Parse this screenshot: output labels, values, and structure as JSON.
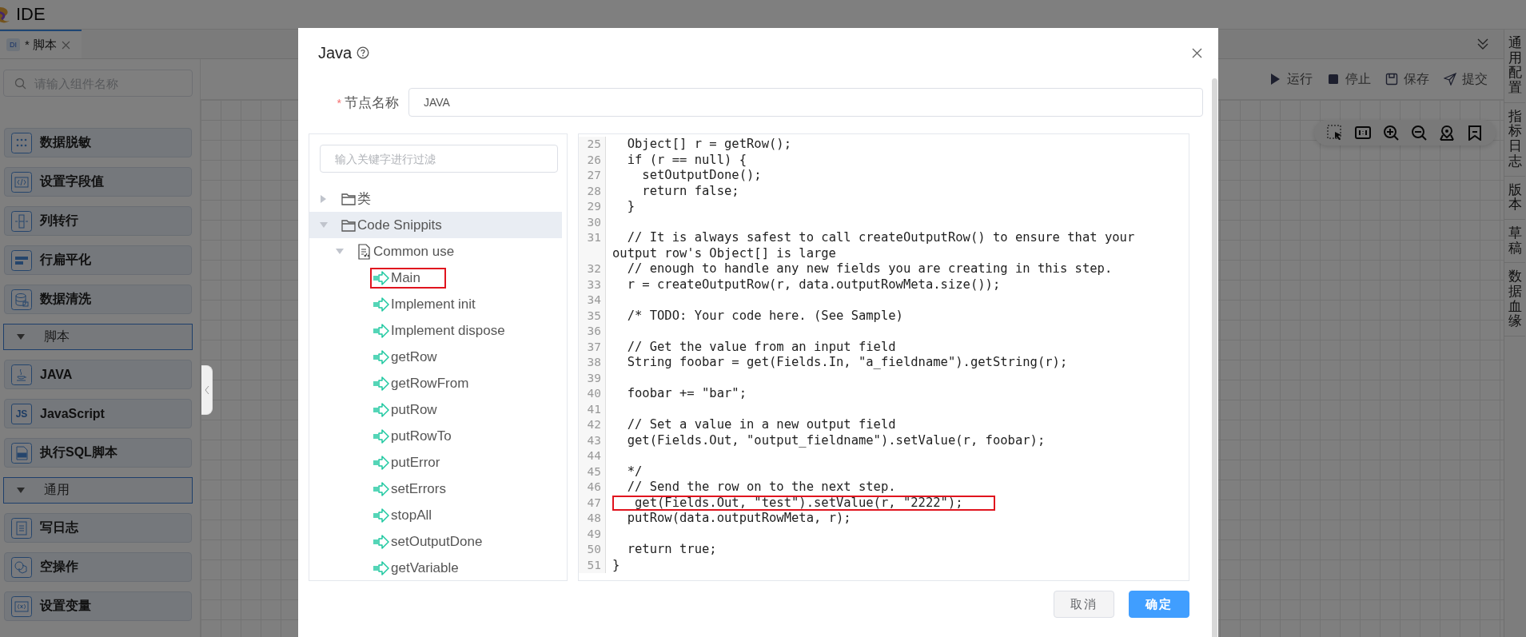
{
  "app": {
    "title": "IDE"
  },
  "tabs": [
    {
      "badge": "DI",
      "label": "* 脚本",
      "selected": true
    }
  ],
  "sidebar": {
    "search": {
      "placeholder": "请输入组件名称"
    },
    "items": [
      {
        "kind": "item",
        "label": "数据脱敏"
      },
      {
        "kind": "item",
        "label": "设置字段值"
      },
      {
        "kind": "item",
        "label": "列转行"
      },
      {
        "kind": "item",
        "label": "行扁平化"
      },
      {
        "kind": "item",
        "label": "数据清洗"
      },
      {
        "kind": "group",
        "label": "脚本",
        "expanded": true
      },
      {
        "kind": "item",
        "label": "JAVA"
      },
      {
        "kind": "item",
        "label": "JavaScript",
        "badge": "JS"
      },
      {
        "kind": "item",
        "label": "执行SQL脚本"
      },
      {
        "kind": "group",
        "label": "通用",
        "expanded": true
      },
      {
        "kind": "item",
        "label": "写日志"
      },
      {
        "kind": "item",
        "label": "空操作"
      },
      {
        "kind": "item",
        "label": "设置变量"
      }
    ]
  },
  "toolbar": {
    "actions": [
      "运行",
      "停止",
      "保存",
      "提交"
    ]
  },
  "side_tabs": [
    "通用配置",
    "指标日志",
    "版本",
    "草稿",
    "数据血缘"
  ],
  "dialog": {
    "title": "Java",
    "node_name": {
      "required_mark": "*",
      "label": "节点名称",
      "value": "JAVA"
    },
    "tree": {
      "filter": {
        "placeholder": "输入关键字进行过滤"
      },
      "nodes": [
        {
          "kind": "folder",
          "label": "类",
          "expanded": false,
          "selected": false,
          "marked": false
        },
        {
          "kind": "folder",
          "label": "Code Snippits",
          "expanded": true,
          "selected": true,
          "marked": false,
          "children": [
            {
              "kind": "file",
              "label": "Common use",
              "expanded": true,
              "selected": false,
              "marked": false,
              "children": [
                {
                  "kind": "snippet",
                  "label": "Main",
                  "selected": false,
                  "marked": true
                },
                {
                  "kind": "snippet",
                  "label": "Implement init",
                  "selected": false,
                  "marked": false
                },
                {
                  "kind": "snippet",
                  "label": "Implement dispose",
                  "selected": false,
                  "marked": false
                },
                {
                  "kind": "snippet",
                  "label": "getRow",
                  "selected": false,
                  "marked": false
                },
                {
                  "kind": "snippet",
                  "label": "getRowFrom",
                  "selected": false,
                  "marked": false
                },
                {
                  "kind": "snippet",
                  "label": "putRow",
                  "selected": false,
                  "marked": false
                },
                {
                  "kind": "snippet",
                  "label": "putRowTo",
                  "selected": false,
                  "marked": false
                },
                {
                  "kind": "snippet",
                  "label": "putError",
                  "selected": false,
                  "marked": false
                },
                {
                  "kind": "snippet",
                  "label": "setErrors",
                  "selected": false,
                  "marked": false
                },
                {
                  "kind": "snippet",
                  "label": "stopAll",
                  "selected": false,
                  "marked": false
                },
                {
                  "kind": "snippet",
                  "label": "setOutputDone",
                  "selected": false,
                  "marked": false
                },
                {
                  "kind": "snippet",
                  "label": "getVariable",
                  "selected": false,
                  "marked": false
                }
              ]
            }
          ]
        }
      ]
    },
    "code": {
      "lines": [
        {
          "n": "25",
          "text": "  Object[] r = getRow();",
          "marked": false
        },
        {
          "n": "26",
          "text": "  if (r == null) {",
          "marked": false
        },
        {
          "n": "27",
          "text": "    setOutputDone();",
          "marked": false
        },
        {
          "n": "28",
          "text": "    return false;",
          "marked": false
        },
        {
          "n": "29",
          "text": "  }",
          "marked": false
        },
        {
          "n": "30",
          "marked": false
        },
        {
          "n": "31",
          "text": "  // It is always safest to call createOutputRow() to ensure that your output row's Object[] is large",
          "marked": false
        },
        {
          "n": "32",
          "text": "  // enough to handle any new fields you are creating in this step.",
          "marked": false
        },
        {
          "n": "33",
          "text": "  r = createOutputRow(r, data.outputRowMeta.size());",
          "marked": false
        },
        {
          "n": "34",
          "marked": false
        },
        {
          "n": "35",
          "text": "  /* TODO: Your code here. (See Sample)",
          "marked": false
        },
        {
          "n": "36",
          "marked": false
        },
        {
          "n": "37",
          "text": "  // Get the value from an input field",
          "marked": false
        },
        {
          "n": "38",
          "text": "  String foobar = get(Fields.In, \"a_fieldname\").getString(r);",
          "marked": false
        },
        {
          "n": "39",
          "marked": false
        },
        {
          "n": "40",
          "text": "  foobar += \"bar\";",
          "marked": false
        },
        {
          "n": "41",
          "marked": false
        },
        {
          "n": "42",
          "text": "  // Set a value in a new output field",
          "marked": false
        },
        {
          "n": "43",
          "text": "  get(Fields.Out, \"output_fieldname\").setValue(r, foobar);",
          "marked": false
        },
        {
          "n": "44",
          "marked": false
        },
        {
          "n": "45",
          "text": "  */",
          "marked": false
        },
        {
          "n": "46",
          "text": "  // Send the row on to the next step.",
          "marked": false
        },
        {
          "n": "47",
          "text": "   get(Fields.Out, \"test\").setValue(r, \"2222\");",
          "marked": true
        },
        {
          "n": "48",
          "text": "  putRow(data.outputRowMeta, r);",
          "marked": false
        },
        {
          "n": "49",
          "marked": false
        },
        {
          "n": "50",
          "text": "  return true;",
          "marked": false
        },
        {
          "n": "51",
          "text": "}",
          "marked": false
        }
      ]
    },
    "buttons": [
      {
        "label": "取消",
        "kind": "secondary"
      },
      {
        "label": "确定",
        "kind": "primary"
      }
    ]
  }
}
